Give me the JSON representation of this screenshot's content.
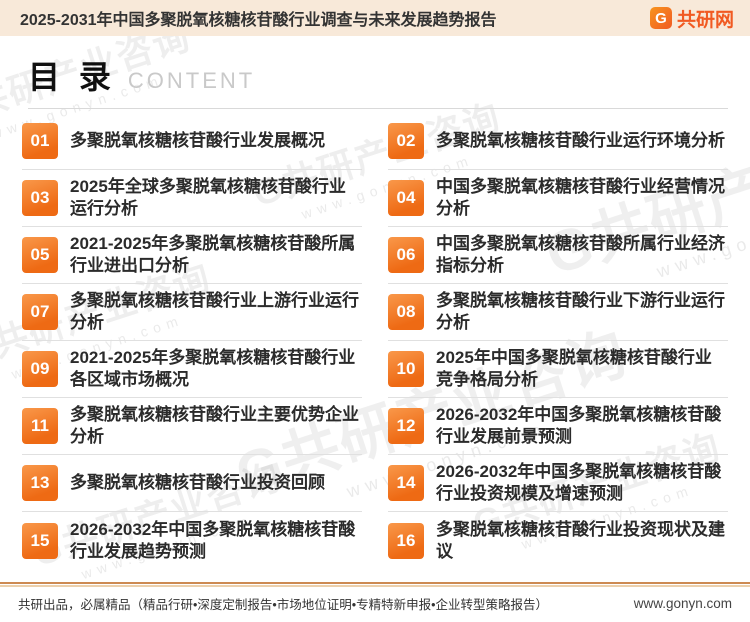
{
  "header": {
    "title": "2025-2031年中国多聚脱氧核糖核苷酸行业调查与未来发展趋势报告",
    "logo_mark": "G",
    "logo_text": "共研网"
  },
  "heading": {
    "title_cn": "目 录",
    "title_en": "CONTENT"
  },
  "toc": {
    "left": [
      {
        "num": "01",
        "title": "多聚脱氧核糖核苷酸行业发展概况"
      },
      {
        "num": "03",
        "title": "2025年全球多聚脱氧核糖核苷酸行业运行分析"
      },
      {
        "num": "05",
        "title": "2021-2025年多聚脱氧核糖核苷酸所属行业进出口分析"
      },
      {
        "num": "07",
        "title": "多聚脱氧核糖核苷酸行业上游行业运行分析"
      },
      {
        "num": "09",
        "title": "2021-2025年多聚脱氧核糖核苷酸行业各区域市场概况"
      },
      {
        "num": "11",
        "title": "多聚脱氧核糖核苷酸行业主要优势企业分析"
      },
      {
        "num": "13",
        "title": "多聚脱氧核糖核苷酸行业投资回顾"
      },
      {
        "num": "15",
        "title": "2026-2032年中国多聚脱氧核糖核苷酸行业发展趋势预测"
      }
    ],
    "right": [
      {
        "num": "02",
        "title": "多聚脱氧核糖核苷酸行业运行环境分析"
      },
      {
        "num": "04",
        "title": "中国多聚脱氧核糖核苷酸行业经营情况分析"
      },
      {
        "num": "06",
        "title": "中国多聚脱氧核糖核苷酸所属行业经济指标分析"
      },
      {
        "num": "08",
        "title": "多聚脱氧核糖核苷酸行业下游行业运行分析"
      },
      {
        "num": "10",
        "title": "2025年中国多聚脱氧核糖核苷酸行业竞争格局分析"
      },
      {
        "num": "12",
        "title": "2026-2032年中国多聚脱氧核糖核苷酸行业发展前景预测"
      },
      {
        "num": "14",
        "title": "2026-2032年中国多聚脱氧核糖核苷酸行业投资规模及增速预测"
      },
      {
        "num": "16",
        "title": "多聚脱氧核糖核苷酸行业投资现状及建议"
      }
    ]
  },
  "watermark": {
    "brand": "G共研产业咨询",
    "url": "www.gonyn.com"
  },
  "footer": {
    "slogan": "共研出品，必属精品（精品行研•深度定制报告•市场地位证明•专精特新申报•企业转型策略报告）",
    "url": "www.gonyn.com"
  },
  "colors": {
    "accent_orange": "#ee6a14",
    "header_bg": "#f8e9d9",
    "footer_rule_dark": "#cd8a52",
    "footer_rule_light": "#ecd0ac"
  }
}
